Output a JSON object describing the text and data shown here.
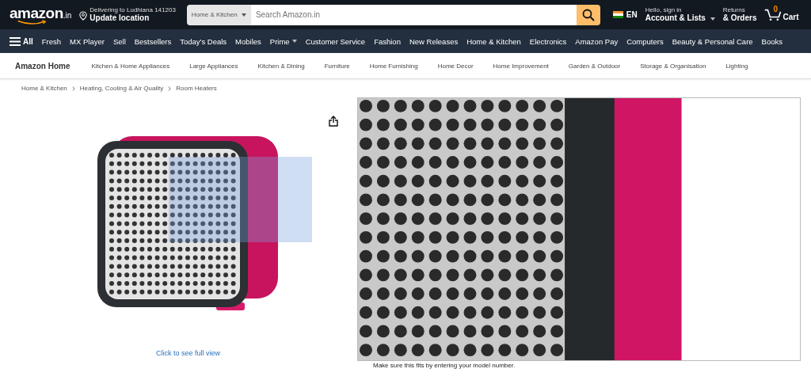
{
  "header": {
    "logo": "amazon",
    "logo_suffix": ".in",
    "delivery_line": "Delivering to Ludhiana 141203",
    "location_link": "Update location",
    "search_category": "Home & Kitchen",
    "search_placeholder": "Search Amazon.in",
    "language": "EN",
    "greeting": "Hello, sign in",
    "account": "Account & Lists",
    "returns": "Returns",
    "orders": "& Orders",
    "cart_count": "0",
    "cart": "Cart"
  },
  "nav": {
    "all": "All",
    "items": [
      {
        "label": "Fresh",
        "dropdown": false
      },
      {
        "label": "MX Player",
        "dropdown": false
      },
      {
        "label": "Sell",
        "dropdown": false
      },
      {
        "label": "Bestsellers",
        "dropdown": false
      },
      {
        "label": "Today's Deals",
        "dropdown": false
      },
      {
        "label": "Mobiles",
        "dropdown": false
      },
      {
        "label": "Prime",
        "dropdown": true
      },
      {
        "label": "Customer Service",
        "dropdown": false
      },
      {
        "label": "Fashion",
        "dropdown": false
      },
      {
        "label": "New Releases",
        "dropdown": false
      },
      {
        "label": "Home & Kitchen",
        "dropdown": false
      },
      {
        "label": "Electronics",
        "dropdown": false
      },
      {
        "label": "Amazon Pay",
        "dropdown": false
      },
      {
        "label": "Computers",
        "dropdown": false
      },
      {
        "label": "Beauty & Personal Care",
        "dropdown": false
      },
      {
        "label": "Books",
        "dropdown": false
      }
    ]
  },
  "subnav": {
    "title": "Amazon Home",
    "items": [
      "Kitchen & Home Appliances",
      "Large Appliances",
      "Kitchen & Dining",
      "Furniture",
      "Home Furnishing",
      "Home Decor",
      "Home Improvement",
      "Garden & Outdoor",
      "Storage & Organisation",
      "Lighting"
    ]
  },
  "breadcrumb": [
    "Home & Kitchen",
    "Heating, Cooling & Air Quality",
    "Room Heaters"
  ],
  "product": {
    "full_view_link": "Click to see full view",
    "bullet": "Make sure this fits by entering your model number."
  }
}
